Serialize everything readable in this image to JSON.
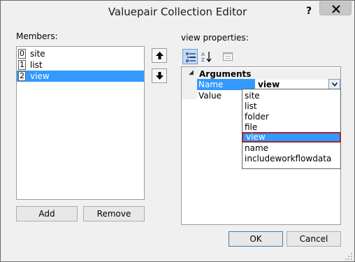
{
  "window": {
    "title": "Valuepair Collection Editor",
    "help_label": "?"
  },
  "members": {
    "label": "Members:",
    "items": [
      {
        "index": "0",
        "name": "site"
      },
      {
        "index": "1",
        "name": "list"
      },
      {
        "index": "2",
        "name": "view"
      }
    ],
    "selected_index": 2,
    "add_label": "Add",
    "remove_label": "Remove"
  },
  "properties": {
    "label": "view properties:",
    "category": "Arguments",
    "rows": [
      {
        "name": "Name",
        "value": "view"
      },
      {
        "name": "Value",
        "value": ""
      }
    ],
    "dropdown_options": [
      "site",
      "list",
      "folder",
      "file",
      "view",
      "name",
      "includeworkflowdata"
    ],
    "dropdown_selected": "view"
  },
  "footer": {
    "ok_label": "OK",
    "cancel_label": "Cancel"
  },
  "colors": {
    "selection": "#3399ff",
    "dialog_bg": "#f0f0f0",
    "highlight_border": "#a0282d"
  }
}
